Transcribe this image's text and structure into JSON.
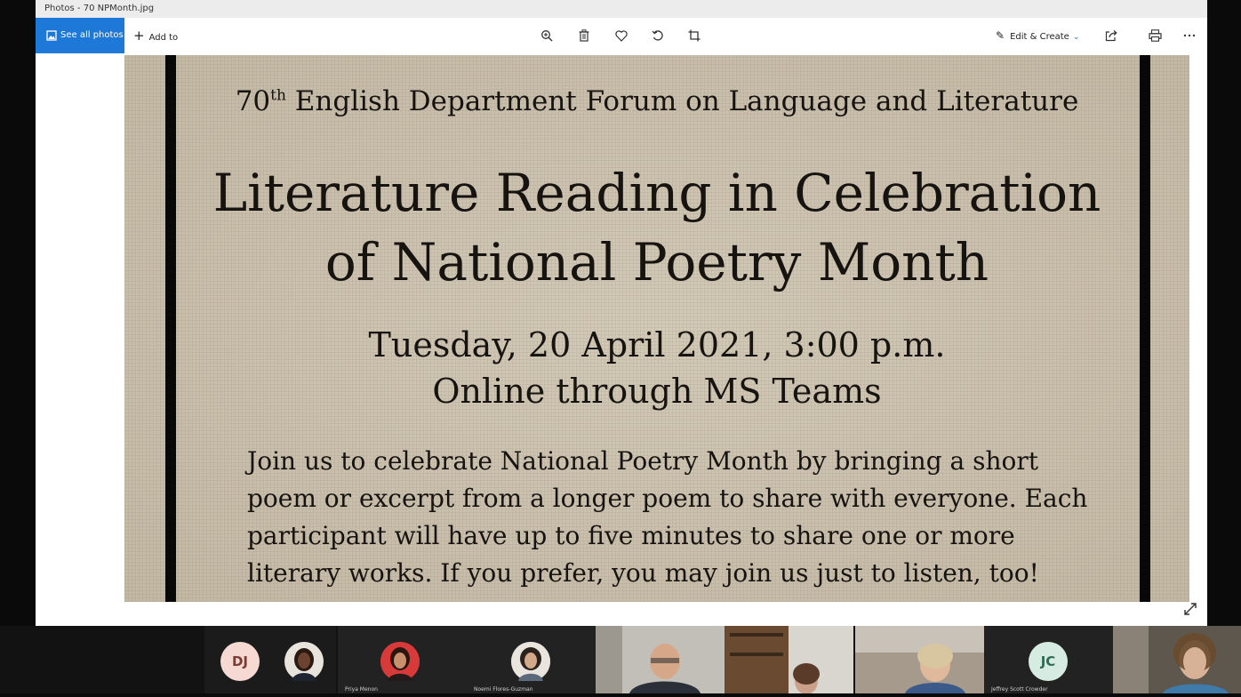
{
  "window": {
    "title": "Photos - 70 NPMonth.jpg"
  },
  "toolbar": {
    "see_all_photos": "See all photos",
    "add_to": "Add to",
    "edit_create": "Edit & Create"
  },
  "icons": {
    "see_all": "image-icon",
    "add": "plus-icon",
    "zoom": "zoom-in-icon",
    "delete": "trash-icon",
    "favorite": "heart-icon",
    "rotate": "rotate-icon",
    "crop": "crop-icon",
    "edit": "edit-create-icon",
    "share": "share-icon",
    "print": "print-icon",
    "more": "more-icon",
    "expand": "expand-icon"
  },
  "poster": {
    "forum_number": "70",
    "forum_suffix": "th",
    "forum_rest": " English Department Forum on Language and Literature",
    "headline_line1": "Literature Reading in Celebration",
    "headline_line2": "of National Poetry Month",
    "date_line": "Tuesday, 20 April 2021, 3:00 p.m.",
    "venue_line": "Online through MS Teams",
    "body_lines": [
      "Join us to celebrate National Poetry Month by bringing a short",
      "poem or excerpt from a longer poem to share with everyone. Each",
      "participant will have up to five minutes to share one or more",
      "literary works.  If you prefer, you may join us just to listen, too!"
    ]
  },
  "colors": {
    "accent": "#1e78d7",
    "poster_bg": "#c9bfac",
    "poster_text": "#161310"
  },
  "participants": {
    "dj_initials": "DJ",
    "priya": "Priya Menon",
    "noemi": "Noemi Flores-Guzman",
    "jc_initials": "JC",
    "jeffrey": "Jeffrey Scott Crowder"
  }
}
